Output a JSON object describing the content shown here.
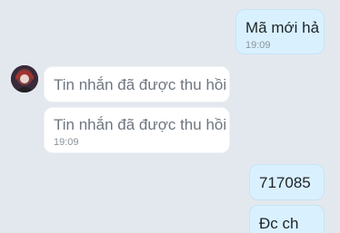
{
  "conversation": {
    "messages": [
      {
        "direction": "sent",
        "text": "Mã mới hả",
        "time": "19:09"
      },
      {
        "direction": "received",
        "text": "Tin nhắn đã được thu hồi",
        "time": ""
      },
      {
        "direction": "received",
        "text": "Tin nhắn đã được thu hồi",
        "time": "19:09"
      },
      {
        "direction": "sent",
        "text": "717085",
        "time": ""
      },
      {
        "direction": "sent",
        "text": "Đc ch",
        "time": ""
      }
    ]
  },
  "colors": {
    "background": "#e3e8ee",
    "sent_bubble": "#d9f1ff",
    "received_bubble": "#ffffff",
    "recalled_text": "#6e7681"
  },
  "icons": {
    "sender_avatar": "avatar-image"
  }
}
